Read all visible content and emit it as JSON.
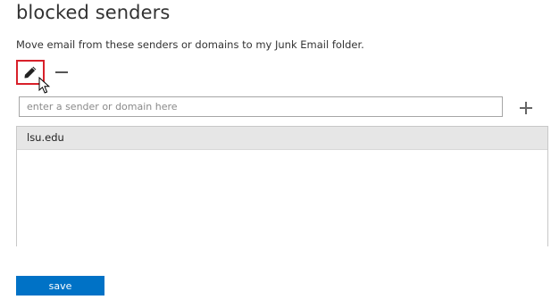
{
  "page": {
    "title": "blocked senders",
    "description": "Move email from these senders or domains to my Junk Email folder."
  },
  "toolbar": {
    "edit_icon": "pencil-icon",
    "remove_icon": "minus-icon",
    "edit_highlight_color": "#d8202a"
  },
  "input": {
    "value": "",
    "placeholder": "enter a sender or domain here",
    "add_icon": "plus-icon"
  },
  "senders": {
    "items": [
      {
        "label": "lsu.edu",
        "selected": true
      }
    ]
  },
  "footer": {
    "save_label": "save",
    "save_color": "#0072c6"
  }
}
